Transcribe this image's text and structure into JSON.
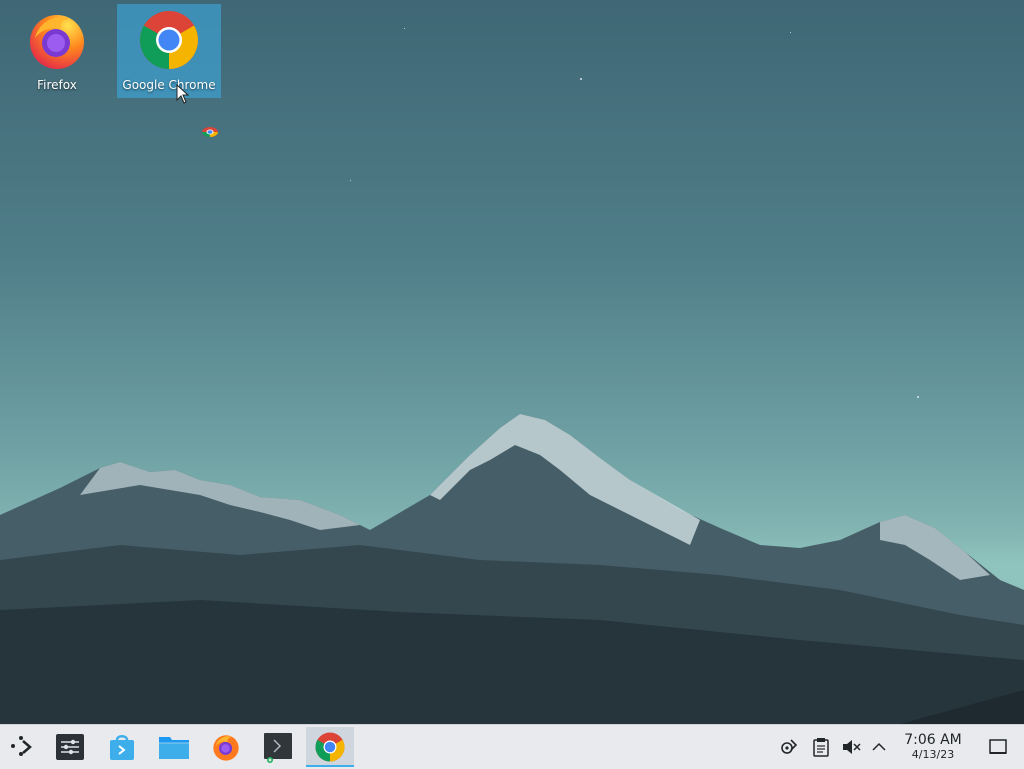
{
  "desktop": {
    "icons": [
      {
        "label": "Firefox",
        "icon": "firefox-icon",
        "selected": false
      },
      {
        "label": "Google Chrome",
        "icon": "chrome-icon",
        "selected": true
      }
    ]
  },
  "taskbar": {
    "items": [
      {
        "icon": "application-launcher-icon"
      },
      {
        "icon": "system-settings-icon"
      },
      {
        "icon": "discover-store-icon"
      },
      {
        "icon": "dolphin-file-manager-icon"
      },
      {
        "icon": "firefox-icon"
      },
      {
        "icon": "konsole-terminal-icon"
      },
      {
        "icon": "chrome-icon",
        "active": true
      }
    ],
    "tray": {
      "icons": [
        "kde-connect-icon",
        "clipboard-icon",
        "volume-muted-icon",
        "show-hidden-icons-chevron-up-icon"
      ],
      "clock": {
        "time": "7:06 AM",
        "date": "4/13/23"
      },
      "show_desktop": "show-desktop-icon"
    }
  },
  "colors": {
    "accent": "#3daee9",
    "taskbar_bg": "#e8eaed",
    "desktop_sky": "#4f7d88"
  }
}
